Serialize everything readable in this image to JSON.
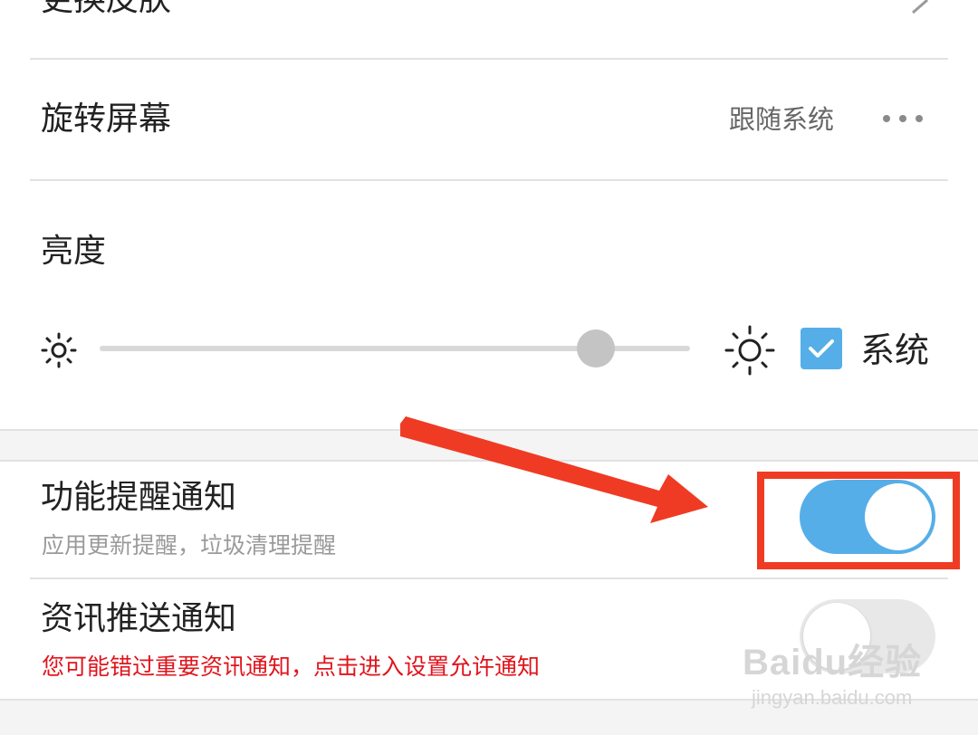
{
  "settings": {
    "skin": {
      "label": "更换皮肤"
    },
    "rotate": {
      "label": "旋转屏幕",
      "value": "跟随系统"
    },
    "brightness": {
      "label": "亮度",
      "level": 0.84,
      "system_checked": true,
      "system_label": "系统"
    },
    "feature_notify": {
      "label": "功能提醒通知",
      "sub": "应用更新提醒，垃圾清理提醒",
      "enabled": true
    },
    "news_notify": {
      "label": "资讯推送通知",
      "warning": "您可能错过重要资讯通知，点击进入设置允许通知",
      "enabled": false
    }
  },
  "colors": {
    "accent": "#55aee8",
    "annotation_red": "#ef3b24",
    "warning_red": "#e0141c"
  },
  "watermark": {
    "brand": "Baidu经验",
    "url": "jingyan.baidu.com"
  }
}
